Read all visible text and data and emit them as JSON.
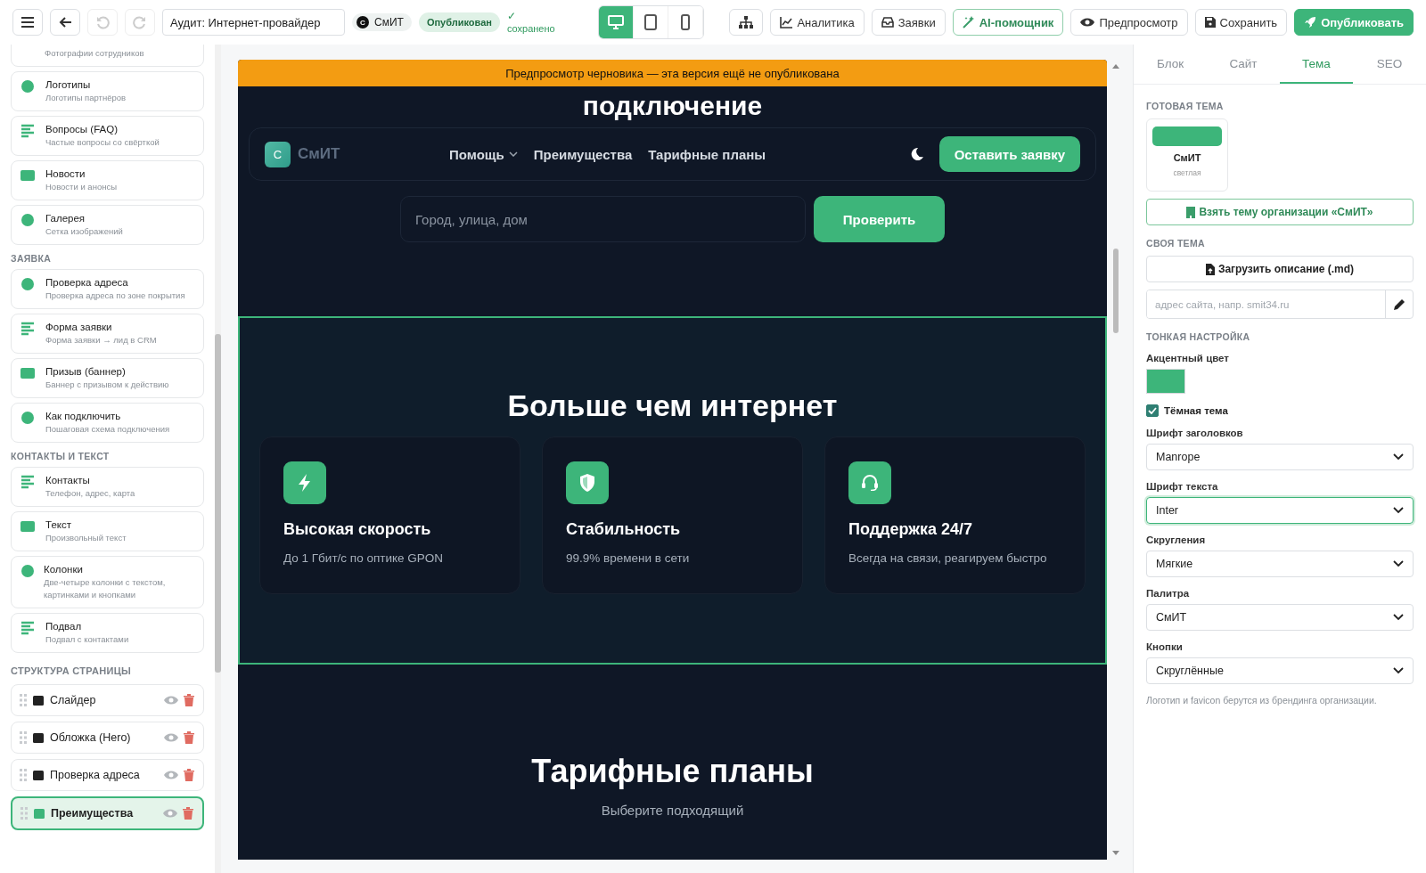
{
  "toolbar": {
    "title_value": "Аудит: Интернет-провайдер",
    "org": {
      "initial": "С",
      "name": "СмИТ"
    },
    "status": "Опубликован",
    "saved": {
      "mark": "✓",
      "text": "сохранено"
    },
    "undo_disabled": true,
    "redo_disabled": true,
    "devices": [
      {
        "kind": "desktop",
        "selected": true
      },
      {
        "kind": "tablet",
        "selected": false
      },
      {
        "kind": "mobile",
        "selected": false
      }
    ],
    "actions": [
      {
        "kind": "sitemap"
      },
      {
        "kind": "chart",
        "label": "Аналитика"
      },
      {
        "kind": "inbox",
        "label": "Заявки"
      },
      {
        "kind": "ai",
        "label": "AI-помощник"
      },
      {
        "kind": "eye",
        "label": "Предпросмотр"
      },
      {
        "kind": "save",
        "label": "Сохранить"
      },
      {
        "kind": "publish",
        "label": "Опубликовать"
      }
    ]
  },
  "library": [
    {
      "items": [
        {
          "subtitle": "Фотографии сотрудников"
        },
        {
          "title": "Логотипы",
          "subtitle": "Логотипы партнёров"
        },
        {
          "title": "Вопросы (FAQ)",
          "subtitle": "Частые вопросы со свёрткой"
        },
        {
          "title": "Новости",
          "subtitle": "Новости и анонсы"
        },
        {
          "title": "Галерея",
          "subtitle": "Сетка изображений"
        }
      ]
    },
    {
      "heading": "ЗАЯВКА",
      "items": [
        {
          "title": "Проверка адреса",
          "subtitle": "Проверка адреса по зоне покрытия"
        },
        {
          "title": "Форма заявки",
          "subtitle": "Форма заявки → лид в CRM"
        },
        {
          "title": "Призыв (баннер)",
          "subtitle": "Баннер с призывом к действию"
        },
        {
          "title": "Как подключить",
          "subtitle": "Пошаговая схема подключения"
        }
      ]
    },
    {
      "heading": "КОНТАКТЫ И ТЕКСТ",
      "items": [
        {
          "title": "Контакты",
          "subtitle": "Телефон, адрес, карта"
        },
        {
          "title": "Текст",
          "subtitle": "Произвольный текст"
        },
        {
          "title": "Колонки",
          "subtitle": "Две-четыре колонки с текстом, картинками и кнопками"
        },
        {
          "title": "Подвал",
          "subtitle": "Подвал с контактами"
        }
      ]
    }
  ],
  "structure": {
    "heading": "СТРУКТУРА СТРАНИЦЫ",
    "items": [
      {
        "label": "Слайдер",
        "selected": false
      },
      {
        "label": "Обложка (Hero)",
        "selected": false
      },
      {
        "label": "Проверка адреса",
        "selected": false
      },
      {
        "label": "Преимущества",
        "selected": true
      }
    ]
  },
  "preview": {
    "banner": "Предпросмотр черновика — эта версия ещё не опубликована",
    "hero_heading": "подключение",
    "nav": {
      "logo_initial": "С",
      "logo_text": "СмИТ",
      "links": [
        {
          "label": "Помощь",
          "dropdown": true
        },
        {
          "label": "Преимущества",
          "dropdown": false
        },
        {
          "label": "Тарифные планы",
          "dropdown": false
        }
      ],
      "cta": "Оставить заявку"
    },
    "address": {
      "placeholder": "Город, улица, дом",
      "button": "Проверить"
    },
    "features": {
      "selected": true,
      "heading": "Больше чем интернет",
      "cards": [
        {
          "kind": "bolt",
          "title": "Высокая скорость",
          "text": "До 1 Гбит/с по оптике GPON"
        },
        {
          "kind": "shield",
          "title": "Стабильность",
          "text": "99.9% времени в сети"
        },
        {
          "kind": "headset",
          "title": "Поддержка 24/7",
          "text": "Всегда на связи, реагируем быстро"
        }
      ]
    },
    "tariffs": {
      "heading": "Тарифные планы",
      "subtitle": "Выберите подходящий"
    }
  },
  "panel": {
    "tabs": [
      {
        "label": "Блок",
        "selected": false
      },
      {
        "label": "Сайт",
        "selected": false
      },
      {
        "label": "Тема",
        "selected": true
      },
      {
        "label": "SEO",
        "selected": false
      }
    ],
    "ready_heading": "ГОТОВАЯ ТЕМА",
    "theme_card": {
      "name": "СмИТ",
      "mode": "светлая"
    },
    "org_theme_button": "Взять тему организации «СмИТ»",
    "own_heading": "СВОЯ ТЕМА",
    "upload_button": "Загрузить описание (.md)",
    "site_placeholder": "адрес сайта, напр. smit34.ru",
    "fine_heading": "ТОНКАЯ НАСТРОЙКА",
    "accent_label": "Акцентный цвет",
    "dark": {
      "label": "Тёмная тема",
      "checked": true
    },
    "selects": [
      {
        "label": "Шрифт заголовков",
        "value": "Manrope",
        "focused": false
      },
      {
        "label": "Шрифт текста",
        "value": "Inter",
        "focused": true
      },
      {
        "label": "Скругления",
        "value": "Мягкие",
        "focused": false
      },
      {
        "label": "Палитра",
        "value": "СмИТ",
        "focused": false
      },
      {
        "label": "Кнопки",
        "value": "Скруглённые",
        "focused": false
      }
    ],
    "note": "Логотип и favicon берутся из брендинга организации."
  }
}
